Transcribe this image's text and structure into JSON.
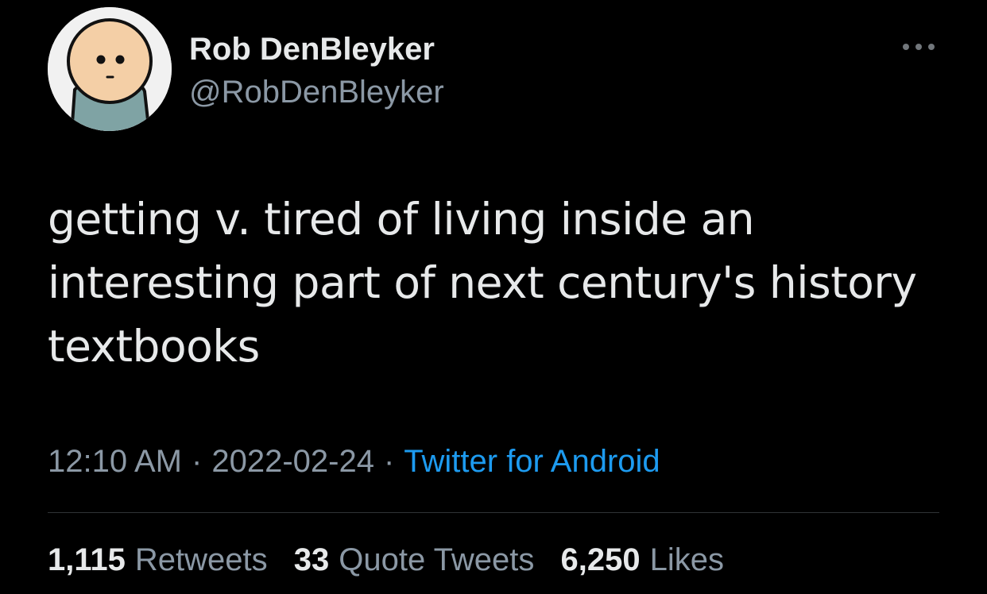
{
  "author": {
    "name": "Rob DenBleyker",
    "handle": "@RobDenBleyker",
    "avatar_icon": "cartoon-face-avatar"
  },
  "more_icon": "more-horizontal-icon",
  "tweet": {
    "lines": [
      "getting v. tired of living inside an",
      "interesting part of next century's history",
      "textbooks"
    ]
  },
  "meta": {
    "time": "12:10 AM",
    "separator": "·",
    "date": "2022-02-24",
    "source": "Twitter for Android"
  },
  "stats": {
    "retweets_count": "1,115",
    "retweets_label": "Retweets",
    "quotes_count": "33",
    "quotes_label": "Quote Tweets",
    "likes_count": "6,250",
    "likes_label": "Likes"
  },
  "colors": {
    "background": "#000000",
    "primary_text": "#e7e9ea",
    "secondary_text": "#8b98a5",
    "link": "#1d9bf0",
    "divider": "#2f3336"
  }
}
